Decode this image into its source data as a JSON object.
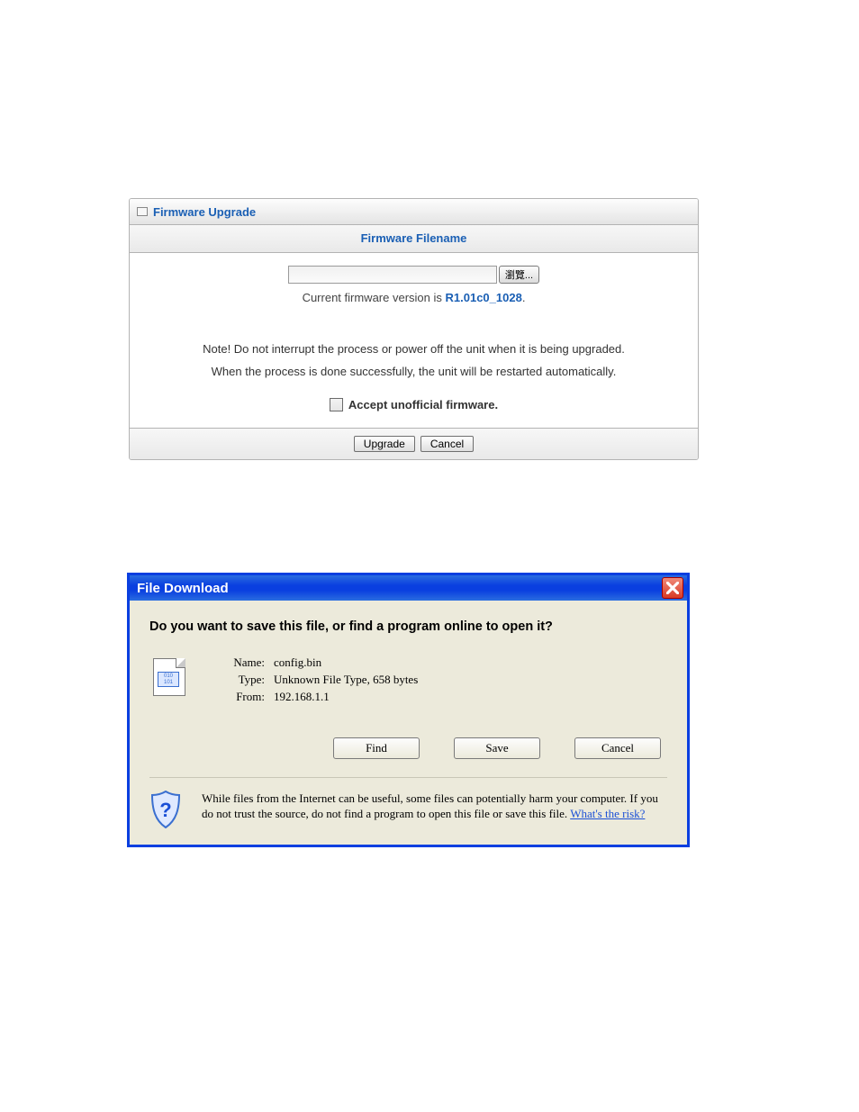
{
  "fw": {
    "title": "Firmware Upgrade",
    "subhead": "Firmware Filename",
    "browse_label": "瀏覽...",
    "version_prefix": "Current firmware version is  ",
    "version": "R1.01c0_1028",
    "version_suffix": ".",
    "note1": "Note! Do not interrupt the process or power off the unit when it is being upgraded.",
    "note2": "When the process is done successfully, the unit will be restarted automatically.",
    "accept_label": "Accept unofficial firmware.",
    "upgrade_label": "Upgrade",
    "cancel_label": "Cancel"
  },
  "dl": {
    "title": "File Download",
    "question": "Do you want to save this file, or find a program online to open it?",
    "name_label": "Name:",
    "name_value": "config.bin",
    "type_label": "Type:",
    "type_value": "Unknown File Type, 658 bytes",
    "from_label": "From:",
    "from_value": "192.168.1.1",
    "find_label": "Find",
    "save_label": "Save",
    "cancel_label": "Cancel",
    "warn_text_1": "While files from the Internet can be useful, some files can potentially harm your computer. If you do not trust the source, do not find a program to open this file or save this file. ",
    "risk_link": "What's the risk?"
  }
}
